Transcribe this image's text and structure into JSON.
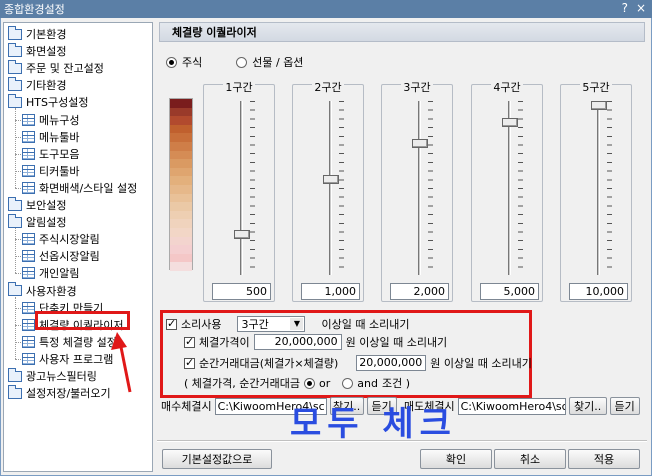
{
  "window": {
    "title": "종합환경설정",
    "help_glyph": "?",
    "close_glyph": "×"
  },
  "tree": {
    "items": [
      {
        "label": "기본환경",
        "type": "folder"
      },
      {
        "label": "화면설정",
        "type": "folder"
      },
      {
        "label": "주문 및 잔고설정",
        "type": "folder"
      },
      {
        "label": "기타환경",
        "type": "folder"
      },
      {
        "label": "HTS구성설정",
        "type": "folder"
      },
      {
        "label": "메뉴구성",
        "type": "item"
      },
      {
        "label": "메뉴툴바",
        "type": "item"
      },
      {
        "label": "도구모음",
        "type": "item"
      },
      {
        "label": "티커툴바",
        "type": "item"
      },
      {
        "label": "화면배색/스타일 설정",
        "type": "item"
      },
      {
        "label": "보안설정",
        "type": "folder"
      },
      {
        "label": "알림설정",
        "type": "folder"
      },
      {
        "label": "주식시장알림",
        "type": "item"
      },
      {
        "label": "선옵시장알림",
        "type": "item"
      },
      {
        "label": "개인알림",
        "type": "item"
      },
      {
        "label": "사용자환경",
        "type": "folder"
      },
      {
        "label": "단축키 만들기",
        "type": "item"
      },
      {
        "label": "체결량 이퀄라이저",
        "type": "item",
        "selected": true
      },
      {
        "label": "특정 체결량 설정",
        "type": "item"
      },
      {
        "label": "사용자 프로그램",
        "type": "item"
      },
      {
        "label": "광고뉴스필터링",
        "type": "folder"
      },
      {
        "label": "설정저장/불러오기",
        "type": "folder"
      }
    ]
  },
  "panel": {
    "title": "체결량 이퀄라이저",
    "type_options": [
      {
        "label": "주식",
        "selected": true
      },
      {
        "label": "선물 / 옵션",
        "selected": false
      }
    ],
    "sections": [
      {
        "label": "1구간",
        "value": "500",
        "level": 0.22
      },
      {
        "label": "2구간",
        "value": "1,000",
        "level": 0.55
      },
      {
        "label": "3구간",
        "value": "2,000",
        "level": 0.77
      },
      {
        "label": "4구간",
        "value": "5,000",
        "level": 0.9
      },
      {
        "label": "5구간",
        "value": "10,000",
        "level": 1.0
      }
    ],
    "sound": {
      "use_label": "소리사용",
      "use_checked": true,
      "section_value": "3구간",
      "section_suffix": "이상일 때 소리내기",
      "price_label": "체결가격이",
      "price_checked": true,
      "price_value": "20,000,000",
      "price_suffix": "원 이상일 때 소리내기",
      "amount_label": "순간거래대금(체결가×체결량)",
      "amount_checked": true,
      "amount_value": "20,000,000",
      "amount_suffix": "원 이상일 때 소리내기",
      "cond_prefix": "( 체결가격, 순간거래대금",
      "cond_or": "or",
      "cond_and": "and",
      "cond_suffix": "조건 )",
      "cond_selected": "or"
    },
    "buy_sound": {
      "label": "매수체결시",
      "path": "C:\\KiwoomHero4\\sc",
      "find": "찾기..",
      "listen": "듣기"
    },
    "sell_sound": {
      "label": "매도체결시",
      "path": "C:\\KiwoomHero4\\sc",
      "find": "찾기..",
      "listen": "듣기"
    }
  },
  "annotation": {
    "text": "모두 체크",
    "color": "#2a4de0",
    "highlight_color": "#e01818"
  },
  "footer": {
    "default_button": "기본설정값으로",
    "ok_button": "확인",
    "cancel_button": "취소",
    "apply_button": "적용"
  },
  "colors": {
    "titlebar": "#5b7fa6",
    "equalizer_top": "#7a1d1d",
    "equalizer_bottom": "#f4c7c7"
  }
}
